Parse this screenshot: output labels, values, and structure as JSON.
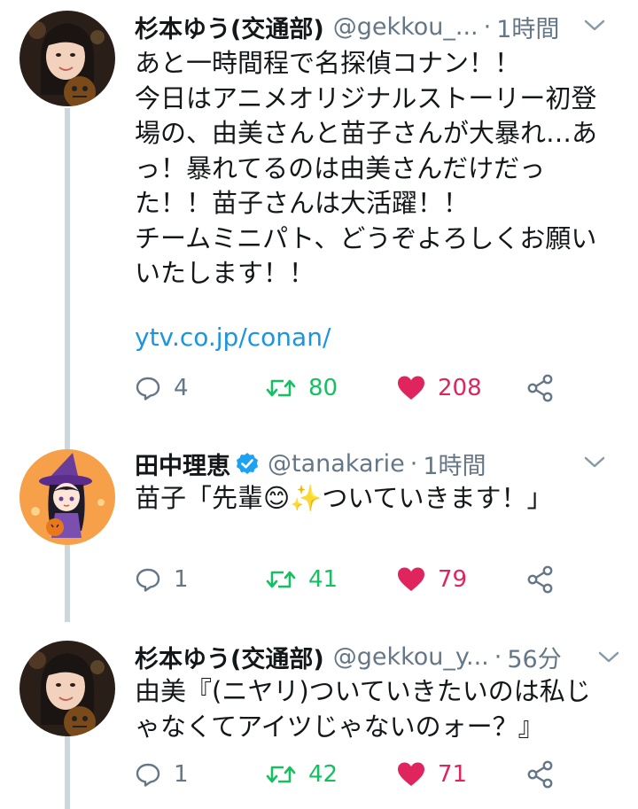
{
  "tweets": [
    {
      "name": "杉本ゆう(交通部)",
      "handle": "@gekkou_...",
      "time": "1時間",
      "lines": [
        "あと一時間程で名探偵コナン！！",
        "今日はアニメオリジナルストーリー初登",
        "場の、由美さんと苗子さんが大暴れ…あ",
        "っ！暴れてるのは由美さんだけだっ",
        "た！！苗子さんは大活躍！！",
        "チームミニパト、どうぞよろしくお願い",
        "いたします！！"
      ],
      "link": "ytv.co.jp/conan/",
      "replies": "4",
      "retweets": "80",
      "likes": "208",
      "avatar_icon": "avatar-photo"
    },
    {
      "name": "田中理恵",
      "handle": "@tanakarie",
      "time": "1時間",
      "verified": true,
      "lines": [
        "苗子「先輩😊✨ついていきます！」"
      ],
      "replies": "1",
      "retweets": "41",
      "likes": "79",
      "avatar_icon": "avatar-witch-illustration"
    },
    {
      "name": "杉本ゆう(交通部)",
      "handle": "@gekkou_y...",
      "time": "56分",
      "lines": [
        "由美『(ニヤリ)ついていきたいのは私じ",
        "ゃなくてアイツじゃないのォー？』"
      ],
      "replies": "1",
      "retweets": "42",
      "likes": "71",
      "avatar_icon": "avatar-photo"
    }
  ],
  "icons": {
    "reply": "reply-icon",
    "retweet": "retweet-icon",
    "like": "heart-icon",
    "share": "share-icon",
    "more": "chevron-down-icon",
    "verified": "verified-badge-icon"
  },
  "colors": {
    "text": "#14171a",
    "muted": "#657786",
    "link": "#1b95e0",
    "retweet": "#17bf63",
    "like": "#e0245e",
    "thread_line": "#ccd6dd"
  }
}
